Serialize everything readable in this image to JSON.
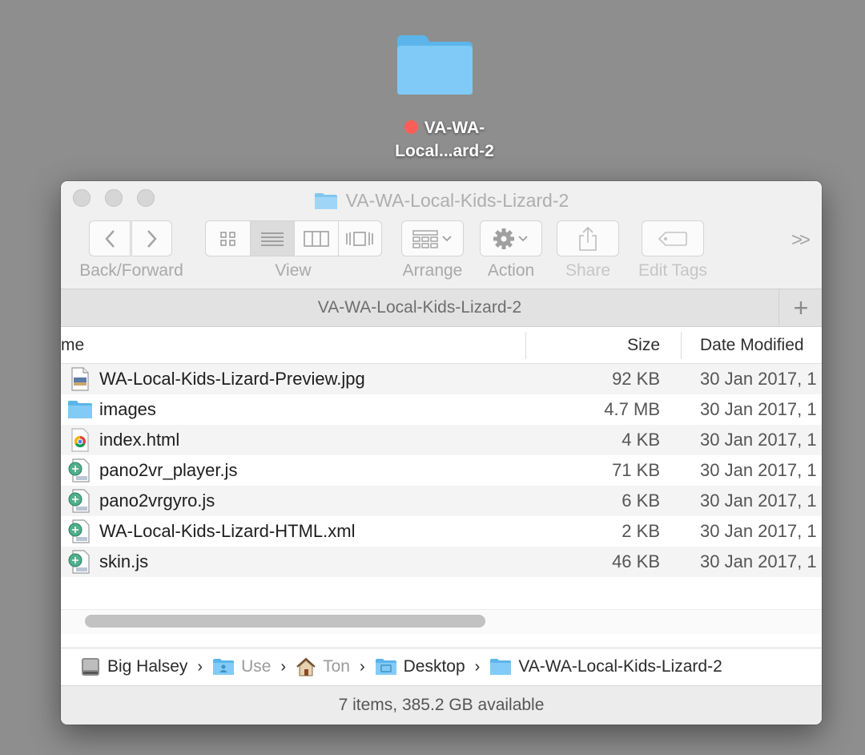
{
  "desktop": {
    "folder_label_line1": "VA-WA-",
    "folder_label_line2": "Local...ard-2",
    "tag_color": "#fc5f57"
  },
  "window": {
    "title": "VA-WA-Local-Kids-Lizard-2",
    "toolbar": {
      "back_forward_label": "Back/Forward",
      "view_label": "View",
      "arrange_label": "Arrange",
      "action_label": "Action",
      "share_label": "Share",
      "edit_tags_label": "Edit Tags",
      "overflow": ">>"
    },
    "tab": {
      "label": "VA-WA-Local-Kids-Lizard-2",
      "add": "+"
    },
    "columns": {
      "name": "me",
      "size": "Size",
      "date": "Date Modified"
    },
    "files": [
      {
        "name": "WA-Local-Kids-Lizard-Preview.jpg",
        "size": "92 KB",
        "date": "30 Jan 2017, 1",
        "icon": "jpg-file-icon"
      },
      {
        "name": "images",
        "size": "4.7 MB",
        "date": "30 Jan 2017, 1",
        "icon": "folder-icon"
      },
      {
        "name": "index.html",
        "size": "4 KB",
        "date": "30 Jan 2017, 1",
        "icon": "chrome-html-icon"
      },
      {
        "name": "pano2vr_player.js",
        "size": "71 KB",
        "date": "30 Jan 2017, 1",
        "icon": "script-file-icon"
      },
      {
        "name": "pano2vrgyro.js",
        "size": "6 KB",
        "date": "30 Jan 2017, 1",
        "icon": "script-file-icon"
      },
      {
        "name": "WA-Local-Kids-Lizard-HTML.xml",
        "size": "2 KB",
        "date": "30 Jan 2017, 1",
        "icon": "script-file-icon"
      },
      {
        "name": "skin.js",
        "size": "46 KB",
        "date": "30 Jan 2017, 1",
        "icon": "script-file-icon"
      }
    ],
    "path": [
      {
        "label": "Big Halsey",
        "icon": "hard-drive-icon"
      },
      {
        "label": "Use",
        "icon": "users-folder-icon"
      },
      {
        "label": "Ton",
        "icon": "home-icon"
      },
      {
        "label": "Desktop",
        "icon": "desktop-folder-icon"
      },
      {
        "label": "VA-WA-Local-Kids-Lizard-2",
        "icon": "folder-icon"
      }
    ],
    "path_separator": "›",
    "status": "7 items, 385.2 GB available"
  }
}
